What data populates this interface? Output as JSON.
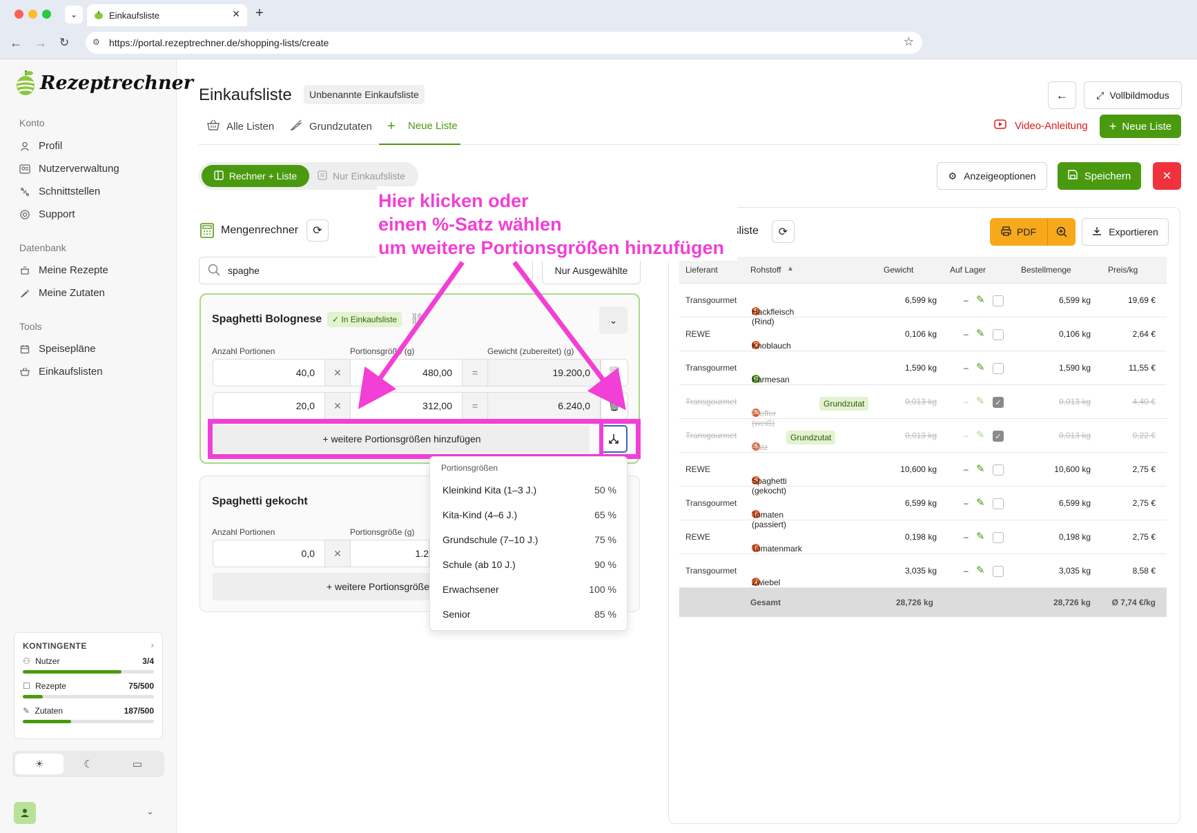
{
  "browser": {
    "tab_title": "Einkaufsliste",
    "url": "https://portal.rezeptrechner.de/shopping-lists/create",
    "new_tab": "+"
  },
  "brand": {
    "name": "Rezeptrechner",
    "accent": "#4a9a0f"
  },
  "sidebar": {
    "sections": [
      {
        "label": "Konto",
        "items": [
          {
            "label": "Profil",
            "icon": "user-icon"
          },
          {
            "label": "Nutzerverwaltung",
            "icon": "users-icon"
          },
          {
            "label": "Schnittstellen",
            "icon": "plug-icon"
          },
          {
            "label": "Support",
            "icon": "lifebuoy-icon"
          }
        ]
      },
      {
        "label": "Datenbank",
        "items": [
          {
            "label": "Meine Rezepte",
            "icon": "pot-icon"
          },
          {
            "label": "Meine Zutaten",
            "icon": "carrot-icon"
          }
        ]
      },
      {
        "label": "Tools",
        "items": [
          {
            "label": "Speisepläne",
            "icon": "calendar-icon"
          },
          {
            "label": "Einkaufslisten",
            "icon": "basket-icon"
          }
        ]
      }
    ],
    "quota": {
      "title": "KONTINGENTE",
      "rows": [
        {
          "label": "Nutzer",
          "used": "3",
          "max": "4",
          "fill": 0.75
        },
        {
          "label": "Rezepte",
          "used": "75",
          "max": "500",
          "fill": 0.15
        },
        {
          "label": "Zutaten",
          "used": "187",
          "max": "500",
          "fill": 0.37
        }
      ]
    },
    "theme": [
      "light",
      "dark",
      "system"
    ]
  },
  "header": {
    "title": "Einkaufsliste",
    "name_badge": "Unbenannte Einkaufsliste",
    "fullscreen": "Vollbildmodus",
    "tabs": [
      "Alle Listen",
      "Grundzutaten",
      "Neue Liste"
    ],
    "video": "Video-Anleitung",
    "new_list": "Neue Liste"
  },
  "toolbar": {
    "mode_calc": "Rechner + Liste",
    "mode_list": "Nur Einkaufsliste",
    "display_options": "Anzeigeoptionen",
    "save": "Speichern"
  },
  "annotation": {
    "line1": "Hier klicken oder",
    "line2": "einen %-Satz wählen",
    "line3": "um weitere Portionsgrößen hinzufügen"
  },
  "calculator": {
    "title": "Mengenrechner",
    "search_value": "spaghe",
    "only_selected": "Nur Ausgewählte",
    "recipes": [
      {
        "name": "Spaghetti Bolognese",
        "badge": "✓ In Einkaufsliste",
        "labels": [
          "Anzahl Portionen",
          "Portionsgröße (g)",
          "Gewicht (zubereitet) (g)"
        ],
        "rows": [
          {
            "portions": "40,0",
            "size": "480,00",
            "weight": "19.200,0"
          },
          {
            "portions": "20,0",
            "size": "312,00",
            "weight": "6.240,0"
          }
        ],
        "add_label": "+ weitere Portionsgrößen hinzufügen"
      },
      {
        "name": "Spaghetti gekocht",
        "labels": [
          "Anzahl Portionen",
          "Portionsgröße (g)"
        ],
        "rows": [
          {
            "portions": "0,0",
            "size": "1.2"
          }
        ],
        "add_label": "+ weitere Portionsgröße"
      }
    ],
    "dropdown": {
      "title": "Portionsgrößen",
      "items": [
        {
          "label": "Kleinkind Kita (1–3 J.)",
          "pct": "50 %"
        },
        {
          "label": "Kita-Kind (4–6 J.)",
          "pct": "65 %"
        },
        {
          "label": "Grundschule (7–10 J.)",
          "pct": "75 %"
        },
        {
          "label": "Schule (ab 10 J.)",
          "pct": "90 %"
        },
        {
          "label": "Erwachsener",
          "pct": "100 %"
        },
        {
          "label": "Senior",
          "pct": "85 %"
        }
      ]
    }
  },
  "shopping": {
    "title_fragment": "fsliste",
    "pdf": "PDF",
    "export": "Exportieren",
    "columns": [
      "Lieferant",
      "Rohstoff",
      "Gewicht",
      "Auf Lager",
      "Bestellmenge",
      "Preis/kg"
    ],
    "rows": [
      {
        "supplier": "Transgourmet",
        "item": "Hackfleisch (Rind)",
        "dot": "S",
        "dot_color": "#e8561c",
        "weight": "6,599 kg",
        "stock": "–",
        "order": "6,599 kg",
        "price": "19,69 €",
        "checked": false,
        "struck": false,
        "badge": ""
      },
      {
        "supplier": "REWE",
        "item": "Knoblauch",
        "dot": "S",
        "dot_color": "#e8561c",
        "weight": "0,106 kg",
        "stock": "–",
        "order": "0,106 kg",
        "price": "2,64 €",
        "checked": false,
        "struck": false,
        "badge": ""
      },
      {
        "supplier": "Transgourmet",
        "item": "Parmesan",
        "dot": "B",
        "dot_color": "#4a9a0f",
        "weight": "1,590 kg",
        "stock": "–",
        "order": "1,590 kg",
        "price": "11,55 €",
        "checked": false,
        "struck": false,
        "badge": ""
      },
      {
        "supplier": "Transgourmet",
        "item": "Pfeffer (weiß)",
        "dot": "S",
        "dot_color": "#e8561c",
        "weight": "0,013 kg",
        "stock": "–",
        "order": "0,013 kg",
        "price": "4,40 €",
        "checked": true,
        "struck": true,
        "badge": "Grundzutat"
      },
      {
        "supplier": "Transgourmet",
        "item": "Salz",
        "dot": "S",
        "dot_color": "#e8561c",
        "weight": "0,013 kg",
        "stock": "–",
        "order": "0,013 kg",
        "price": "0,22 €",
        "checked": true,
        "struck": true,
        "badge": "Grundzutat"
      },
      {
        "supplier": "REWE",
        "item": "Spaghetti (gekocht)",
        "dot": "S",
        "dot_color": "#e8561c",
        "weight": "10,600 kg",
        "stock": "–",
        "order": "10,600 kg",
        "price": "2,75 €",
        "checked": false,
        "struck": false,
        "badge": ""
      },
      {
        "supplier": "Transgourmet",
        "item": "Tomaten (passiert)",
        "dot": "S",
        "dot_color": "#e8561c",
        "weight": "6,599 kg",
        "stock": "–",
        "order": "6,599 kg",
        "price": "2,75 €",
        "checked": false,
        "struck": false,
        "badge": ""
      },
      {
        "supplier": "REWE",
        "item": "Tomatenmark",
        "dot": "S",
        "dot_color": "#e8561c",
        "weight": "0,198 kg",
        "stock": "–",
        "order": "0,198 kg",
        "price": "2,75 €",
        "checked": false,
        "struck": false,
        "badge": ""
      },
      {
        "supplier": "Transgourmet",
        "item": "Zwiebel",
        "dot": "S",
        "dot_color": "#e8561c",
        "weight": "3,035 kg",
        "stock": "–",
        "order": "3,035 kg",
        "price": "8,58 €",
        "checked": false,
        "struck": false,
        "badge": ""
      }
    ],
    "total": {
      "label": "Gesamt",
      "weight": "28,726 kg",
      "order": "28,726 kg",
      "price": "Ø 7,74 €/kg"
    }
  }
}
